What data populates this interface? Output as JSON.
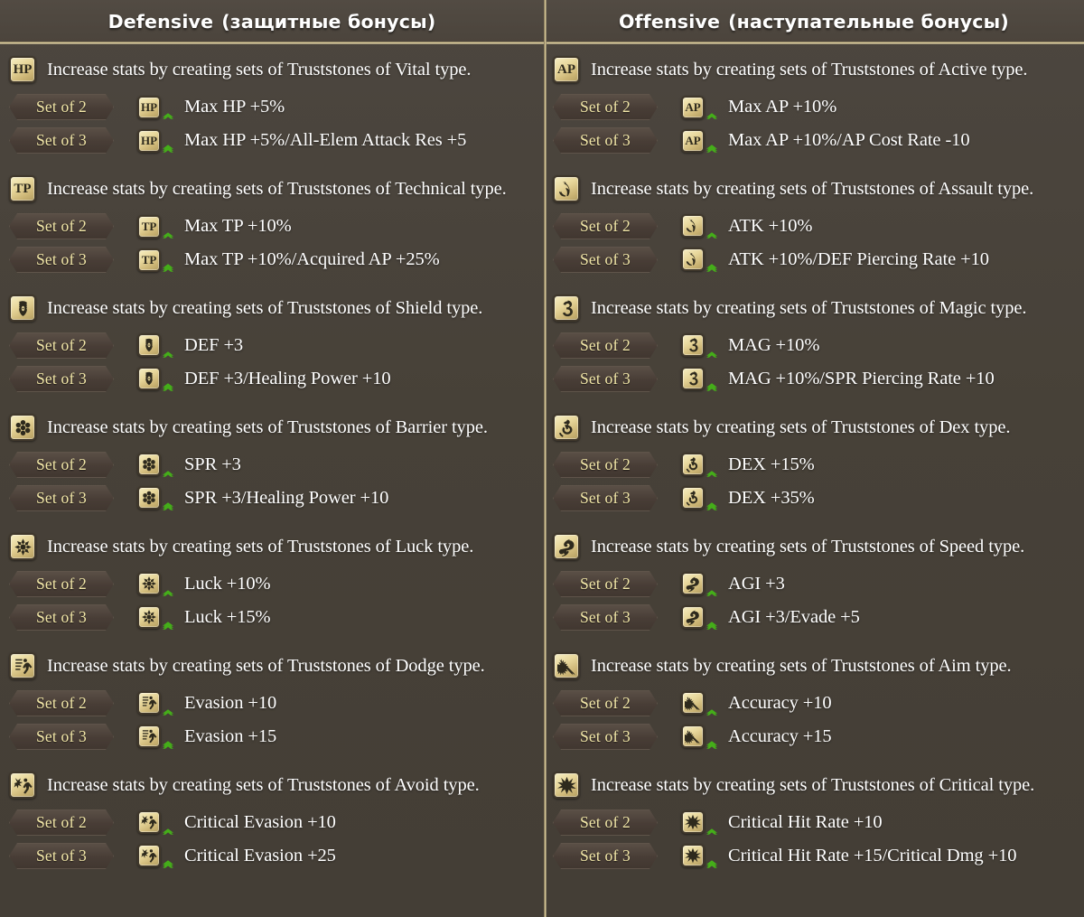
{
  "columns": [
    {
      "id": "defensive",
      "header_en": "Defensive",
      "header_ru": "(защитные бонусы)",
      "groups": [
        {
          "icon": "hp-icon",
          "icon_text": "HP",
          "desc": "Increase stats by creating sets of Truststones of Vital type.",
          "rows": [
            {
              "set_label": "Set of 2",
              "chevrons": 2,
              "effect": "Max HP +5%"
            },
            {
              "set_label": "Set of 3",
              "chevrons": 3,
              "effect": "Max HP +5%/All-Elem Attack Res +5"
            }
          ]
        },
        {
          "icon": "tp-icon",
          "icon_text": "TP",
          "desc": "Increase stats by creating sets of Truststones of Technical type.",
          "rows": [
            {
              "set_label": "Set of 2",
              "chevrons": 2,
              "effect": "Max TP +10%"
            },
            {
              "set_label": "Set of 3",
              "chevrons": 3,
              "effect": "Max TP +10%/Acquired AP +25%"
            }
          ]
        },
        {
          "icon": "shield-icon",
          "icon_text": "",
          "desc": "Increase stats by creating sets of Truststones of Shield type.",
          "rows": [
            {
              "set_label": "Set of 2",
              "chevrons": 2,
              "effect": "DEF +3"
            },
            {
              "set_label": "Set of 3",
              "chevrons": 3,
              "effect": "DEF +3/Healing Power +10"
            }
          ]
        },
        {
          "icon": "barrier-icon",
          "icon_text": "",
          "desc": "Increase stats by creating sets of Truststones of Barrier type.",
          "rows": [
            {
              "set_label": "Set of 2",
              "chevrons": 2,
              "effect": "SPR +3"
            },
            {
              "set_label": "Set of 3",
              "chevrons": 3,
              "effect": "SPR +3/Healing Power +10"
            }
          ]
        },
        {
          "icon": "luck-icon",
          "icon_text": "",
          "desc": "Increase stats by creating sets of Truststones of Luck type.",
          "rows": [
            {
              "set_label": "Set of 2",
              "chevrons": 2,
              "effect": "Luck +10%"
            },
            {
              "set_label": "Set of 3",
              "chevrons": 3,
              "effect": "Luck +15%"
            }
          ]
        },
        {
          "icon": "dodge-icon",
          "icon_text": "",
          "desc": "Increase stats by creating sets of Truststones of Dodge type.",
          "rows": [
            {
              "set_label": "Set of 2",
              "chevrons": 2,
              "effect": "Evasion +10"
            },
            {
              "set_label": "Set of 3",
              "chevrons": 3,
              "effect": "Evasion +15"
            }
          ]
        },
        {
          "icon": "avoid-icon",
          "icon_text": "",
          "desc": "Increase stats by creating sets of Truststones of Avoid type.",
          "rows": [
            {
              "set_label": "Set of 2",
              "chevrons": 2,
              "effect": "Critical Evasion +10"
            },
            {
              "set_label": "Set of 3",
              "chevrons": 3,
              "effect": "Critical Evasion +25"
            }
          ]
        }
      ]
    },
    {
      "id": "offensive",
      "header_en": "Offensive",
      "header_ru": "(наступательные бонусы)",
      "groups": [
        {
          "icon": "ap-icon",
          "icon_text": "AP",
          "desc": "Increase stats by creating sets of Truststones of Active type.",
          "rows": [
            {
              "set_label": "Set of 2",
              "chevrons": 2,
              "effect": "Max AP +10%"
            },
            {
              "set_label": "Set of 3",
              "chevrons": 3,
              "effect": "Max AP +10%/AP Cost Rate -10"
            }
          ]
        },
        {
          "icon": "assault-icon",
          "icon_text": "",
          "desc": "Increase stats by creating sets of Truststones of Assault type.",
          "rows": [
            {
              "set_label": "Set of 2",
              "chevrons": 2,
              "effect": "ATK +10%"
            },
            {
              "set_label": "Set of 3",
              "chevrons": 3,
              "effect": "ATK +10%/DEF Piercing Rate +10"
            }
          ]
        },
        {
          "icon": "magic-icon",
          "icon_text": "",
          "desc": "Increase stats by creating sets of Truststones of Magic type.",
          "rows": [
            {
              "set_label": "Set of 2",
              "chevrons": 2,
              "effect": "MAG +10%"
            },
            {
              "set_label": "Set of 3",
              "chevrons": 3,
              "effect": "MAG +10%/SPR Piercing Rate +10"
            }
          ]
        },
        {
          "icon": "dex-icon",
          "icon_text": "",
          "desc": "Increase stats by creating sets of Truststones of Dex type.",
          "rows": [
            {
              "set_label": "Set of 2",
              "chevrons": 2,
              "effect": "DEX +15%"
            },
            {
              "set_label": "Set of 3",
              "chevrons": 3,
              "effect": "DEX +35%"
            }
          ]
        },
        {
          "icon": "speed-icon",
          "icon_text": "",
          "desc": "Increase stats by creating sets of Truststones of Speed type.",
          "rows": [
            {
              "set_label": "Set of 2",
              "chevrons": 2,
              "effect": "AGI +3"
            },
            {
              "set_label": "Set of 3",
              "chevrons": 3,
              "effect": "AGI +3/Evade +5"
            }
          ]
        },
        {
          "icon": "aim-icon",
          "icon_text": "",
          "desc": "Increase stats by creating sets of Truststones of Aim type.",
          "rows": [
            {
              "set_label": "Set of 2",
              "chevrons": 2,
              "effect": "Accuracy +10"
            },
            {
              "set_label": "Set of 3",
              "chevrons": 3,
              "effect": "Accuracy +15"
            }
          ]
        },
        {
          "icon": "critical-icon",
          "icon_text": "",
          "desc": "Increase stats by creating sets of Truststones of Critical type.",
          "rows": [
            {
              "set_label": "Set of 2",
              "chevrons": 2,
              "effect": "Critical Hit Rate +10"
            },
            {
              "set_label": "Set of 3",
              "chevrons": 3,
              "effect": "Critical Hit Rate +15/Critical Dmg +10"
            }
          ]
        }
      ]
    }
  ],
  "colors": {
    "background": "#474138",
    "divider_gold": "#d8c793",
    "pill_text": "#f2e7a8",
    "chevron_green": "#45b019",
    "tile_gold": "#e7d69a",
    "text": "#ffffff"
  }
}
